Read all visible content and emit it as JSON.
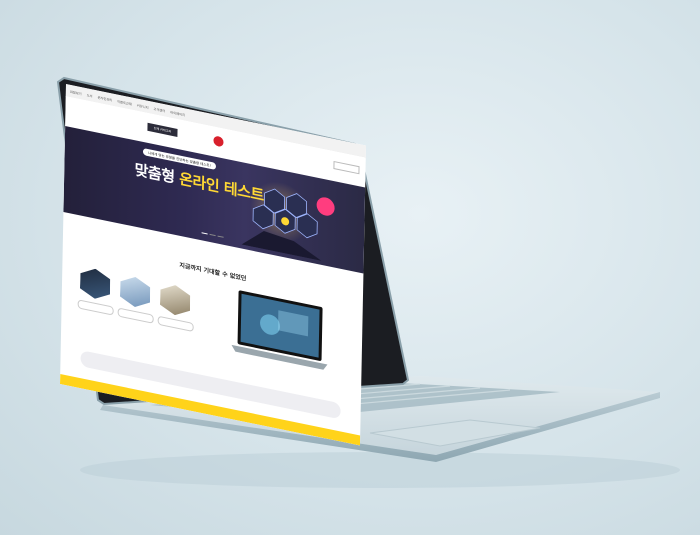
{
  "site": {
    "topbar_links": [
      "파일보기",
      "도서",
      "온라인강의",
      "이벤트교재",
      "커뮤니티",
      "고객센터",
      "마이페이지"
    ],
    "header": {
      "menu_button": "전체 카테고리",
      "logo_text": "",
      "nav_text": "",
      "search_placeholder": ""
    },
    "hero": {
      "pill": "나에게 맞는 유형을 진단하는 맞춤형 테스트!",
      "title_main": "맞춤형",
      "title_highlight": "온라인 테스트",
      "subtitle": "",
      "badge_line1": "",
      "badge_line2": ""
    },
    "section": {
      "title_prefix": "지금까지 기대할 수 없었던",
      "title_highlight": "",
      "title_suffix": "",
      "subtitle": ""
    },
    "features": [
      {
        "label": "",
        "icon": "chart-icon"
      },
      {
        "label": "",
        "icon": "graph-icon"
      },
      {
        "label": "",
        "icon": "book-icon"
      }
    ],
    "notice": {
      "line1": "",
      "line2": ""
    }
  },
  "colors": {
    "accent_yellow": "#ffd834",
    "brand_red": "#d8202c",
    "hero_bg": "#2f2a52",
    "highlight_purple": "#7b3fb8",
    "footer_yellow": "#ffd31a",
    "background": "#d9e6ec"
  }
}
